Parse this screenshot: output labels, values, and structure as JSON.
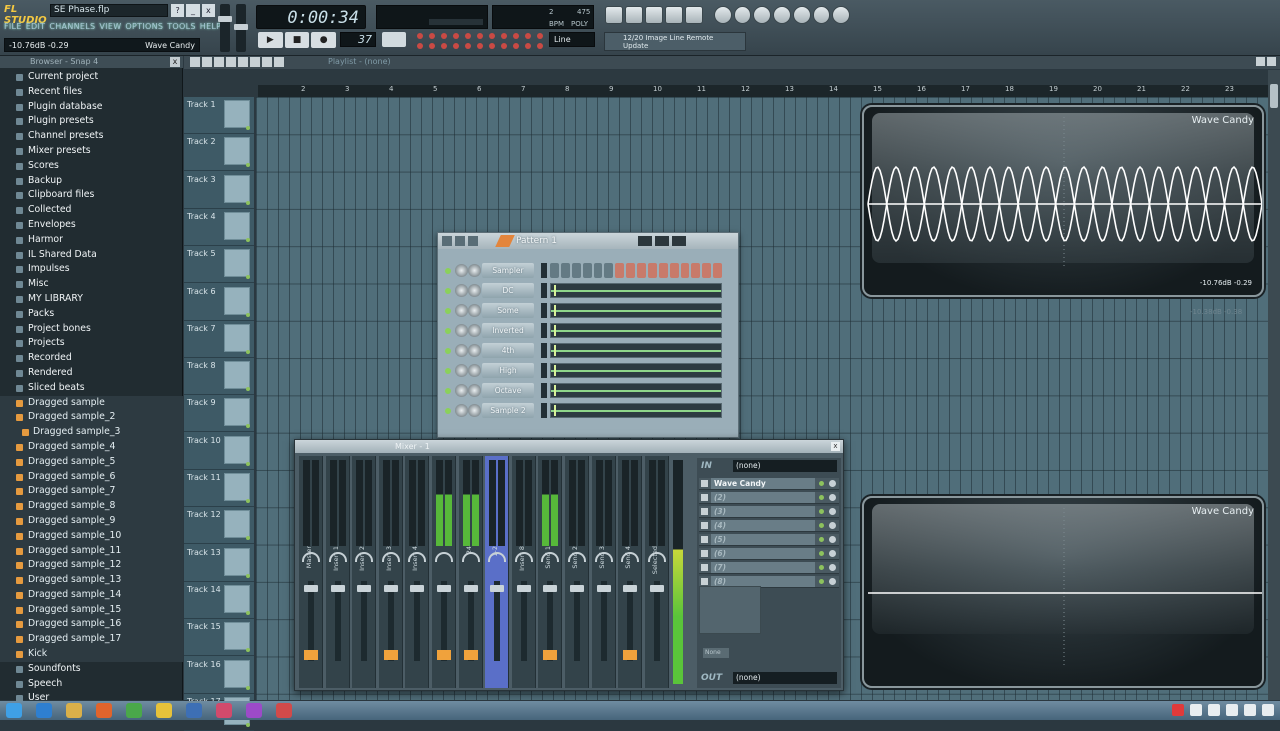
{
  "app": {
    "logo_text": "FL STUDIO",
    "project_file": "SE Phase.flp",
    "menu": [
      "FILE",
      "EDIT",
      "CHANNELS",
      "VIEW",
      "OPTIONS",
      "TOOLS",
      "HELP"
    ],
    "hint_left": "-10.76dB  -0.29",
    "hint_right": "Wave Candy",
    "window_buttons": [
      "?",
      "_",
      "x"
    ]
  },
  "transport": {
    "time": "0:00:34",
    "tempo": "37",
    "snap": "Line",
    "buttons": [
      "▶",
      "■",
      "●"
    ],
    "cpu_a": "2",
    "cpu_b": "475",
    "cpu_c": "BPM",
    "cpu_d": "POLY"
  },
  "news": {
    "line1": "12/20 Image Line Remote",
    "line2": "Update"
  },
  "browser": {
    "header": "Browser - Snap 4",
    "close": "x",
    "items": [
      {
        "label": "Current project",
        "kind": "t"
      },
      {
        "label": "Recent files",
        "kind": "t"
      },
      {
        "label": "Plugin database",
        "kind": "t"
      },
      {
        "label": "Plugin presets",
        "kind": "t"
      },
      {
        "label": "Channel presets",
        "kind": "t"
      },
      {
        "label": "Mixer presets",
        "kind": "t"
      },
      {
        "label": "Scores",
        "kind": "t"
      },
      {
        "label": "Backup",
        "kind": "t"
      },
      {
        "label": "Clipboard files",
        "kind": "t"
      },
      {
        "label": "Collected",
        "kind": "t"
      },
      {
        "label": "Envelopes",
        "kind": "t"
      },
      {
        "label": "Harmor",
        "kind": "t"
      },
      {
        "label": "IL Shared Data",
        "kind": "t"
      },
      {
        "label": "Impulses",
        "kind": "t"
      },
      {
        "label": "Misc",
        "kind": "t"
      },
      {
        "label": "MY LIBRARY",
        "kind": "t"
      },
      {
        "label": "Packs",
        "kind": "t"
      },
      {
        "label": "Project bones",
        "kind": "t"
      },
      {
        "label": "Projects",
        "kind": "t"
      },
      {
        "label": "Recorded",
        "kind": "t"
      },
      {
        "label": "Rendered",
        "kind": "t"
      },
      {
        "label": "Sliced beats",
        "kind": "t"
      },
      {
        "label": "Dragged sample",
        "kind": "f"
      },
      {
        "label": "Dragged sample_2",
        "kind": "f"
      },
      {
        "label": "Dragged sample_3",
        "kind": "sel"
      },
      {
        "label": "Dragged sample_4",
        "kind": "f"
      },
      {
        "label": "Dragged sample_5",
        "kind": "f"
      },
      {
        "label": "Dragged sample_6",
        "kind": "f"
      },
      {
        "label": "Dragged sample_7",
        "kind": "f"
      },
      {
        "label": "Dragged sample_8",
        "kind": "f"
      },
      {
        "label": "Dragged sample_9",
        "kind": "f"
      },
      {
        "label": "Dragged sample_10",
        "kind": "f"
      },
      {
        "label": "Dragged sample_11",
        "kind": "f"
      },
      {
        "label": "Dragged sample_12",
        "kind": "f"
      },
      {
        "label": "Dragged sample_13",
        "kind": "f"
      },
      {
        "label": "Dragged sample_14",
        "kind": "f"
      },
      {
        "label": "Dragged sample_15",
        "kind": "f"
      },
      {
        "label": "Dragged sample_16",
        "kind": "f"
      },
      {
        "label": "Dragged sample_17",
        "kind": "f"
      },
      {
        "label": "Kick",
        "kind": "f"
      },
      {
        "label": "Soundfonts",
        "kind": "t"
      },
      {
        "label": "Speech",
        "kind": "t"
      },
      {
        "label": "User",
        "kind": "t"
      }
    ]
  },
  "playlist": {
    "title": "Playlist - (none)",
    "ruler": [
      "2",
      "3",
      "4",
      "5",
      "6",
      "7",
      "8",
      "9",
      "10",
      "11",
      "12",
      "13",
      "14",
      "15",
      "16",
      "17",
      "18",
      "19",
      "20",
      "21",
      "22",
      "23"
    ],
    "tracks": [
      "Track 1",
      "Track 2",
      "Track 3",
      "Track 4",
      "Track 5",
      "Track 6",
      "Track 7",
      "Track 8",
      "Track 9",
      "Track 10",
      "Track 11",
      "Track 12",
      "Track 13",
      "Track 14",
      "Track 15",
      "Track 16",
      "Track 17"
    ]
  },
  "pattern": {
    "title": "Pattern 1",
    "channels": [
      {
        "name": "Sampler",
        "mode": "steps"
      },
      {
        "name": "DC",
        "mode": "roll"
      },
      {
        "name": "Some",
        "mode": "roll"
      },
      {
        "name": "Inverted",
        "mode": "roll"
      },
      {
        "name": "4th",
        "mode": "roll"
      },
      {
        "name": "High",
        "mode": "roll"
      },
      {
        "name": "Octave",
        "mode": "roll"
      },
      {
        "name": "Sample 2",
        "mode": "roll"
      }
    ]
  },
  "mixer": {
    "title": "Mixer - 1",
    "close": "x",
    "strips": [
      "Master",
      "Insert 1",
      "Insert 2",
      "Insert 3",
      "Insert 4",
      "",
      "24",
      "1-2",
      "Insert 8",
      "Send 1",
      "Send 2",
      "Send 3",
      "Send 4",
      "Selected"
    ],
    "fx_in_label": "IN",
    "fx_in_value": "(none)",
    "slots": [
      {
        "name": "Wave Candy",
        "dim": false
      },
      {
        "name": "(2)",
        "dim": true
      },
      {
        "name": "(3)",
        "dim": true
      },
      {
        "name": "(4)",
        "dim": true
      },
      {
        "name": "(5)",
        "dim": true
      },
      {
        "name": "(6)",
        "dim": true
      },
      {
        "name": "(7)",
        "dim": true
      },
      {
        "name": "(8)",
        "dim": true
      }
    ],
    "fx_none": "None",
    "fx_out_label": "OUT",
    "fx_out_value": "(none)"
  },
  "wave_candy_top": {
    "title": "Wave Candy",
    "readout": "-10.76dB  -0.29",
    "ghost": "-10.38dB  -0.38"
  },
  "wave_candy_bottom": {
    "title": "Wave Candy"
  },
  "icons": {
    "taskbar": [
      "windows-start-icon",
      "ie-icon",
      "explorer-icon",
      "firefox-icon",
      "chrome-icon",
      "fl-studio-icon",
      "app-icon",
      "media-icon",
      "app2-icon",
      "app3-icon"
    ],
    "tray": [
      "record-icon",
      "app-tray-icon",
      "flag-icon",
      "network-icon",
      "volume-icon",
      "battery-icon"
    ]
  }
}
